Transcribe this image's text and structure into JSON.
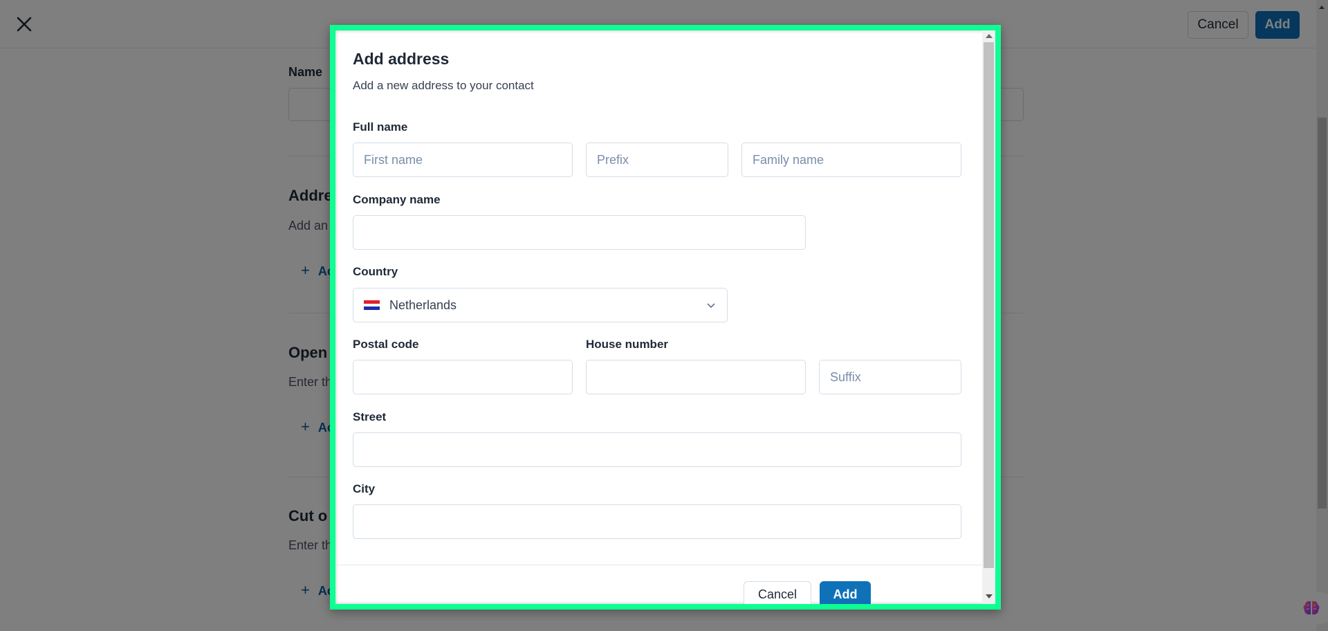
{
  "page": {
    "close_icon": "close-icon",
    "cancel_label": "Cancel",
    "add_label": "Add",
    "name_label": "Name",
    "sections": [
      {
        "title": "Address",
        "description": "Add an address",
        "add_label": "Add"
      },
      {
        "title": "Opening hours",
        "description": "Enter the opening hours",
        "add_label": "Add"
      },
      {
        "title": "Cut off time",
        "description": "Enter the cut off time",
        "add_label": "Add"
      }
    ],
    "section_title_visible": [
      "Addre",
      "Open",
      "Cut o"
    ],
    "section_desc_visible": [
      "Add an",
      "Enter th",
      "Enter th"
    ],
    "section_add_visible": [
      "Ac",
      "Ac",
      "Ac"
    ],
    "assistant_icon": "brain-icon"
  },
  "modal": {
    "title": "Add address",
    "subtitle": "Add a new address to your contact",
    "full_name": {
      "label": "Full name",
      "first_name_placeholder": "First name",
      "first_name_value": "",
      "prefix_placeholder": "Prefix",
      "prefix_value": "",
      "family_name_placeholder": "Family name",
      "family_name_value": ""
    },
    "company_name": {
      "label": "Company name",
      "value": ""
    },
    "country": {
      "label": "Country",
      "value": "Netherlands",
      "flag_colors": [
        "#e3202b",
        "#ffffff",
        "#1a2fa8"
      ]
    },
    "postal_code": {
      "label": "Postal code",
      "value": ""
    },
    "house_number": {
      "label": "House number",
      "value": "",
      "suffix_placeholder": "Suffix",
      "suffix_value": ""
    },
    "street": {
      "label": "Street",
      "value": ""
    },
    "city": {
      "label": "City",
      "value": ""
    },
    "cancel_label": "Cancel",
    "add_label": "Add"
  },
  "colors": {
    "primary": "#0f72b8",
    "highlight_frame": "#0dff92",
    "placeholder": "#7a8ea8"
  }
}
